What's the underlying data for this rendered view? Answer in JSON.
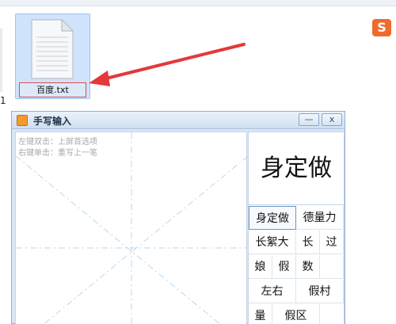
{
  "desktop": {
    "left_fragment": "1",
    "file": {
      "name": "百度.txt"
    },
    "ime_badge": "S"
  },
  "handwriting_window": {
    "title": "手写输入",
    "minimize_label": "—",
    "close_label": "x",
    "hints": [
      "左键双击：上屏首选项",
      "右键单击：重写上一笔"
    ],
    "preview_text": "身定做",
    "candidates": [
      "身定做",
      "德量力",
      "长絮大",
      "长",
      "过",
      "娘",
      "假",
      "数",
      "左右",
      "假村",
      "量",
      "假区"
    ]
  }
}
